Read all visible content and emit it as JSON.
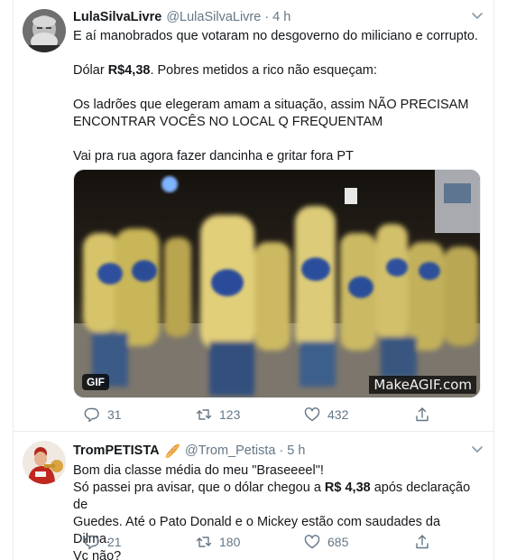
{
  "tweets": [
    {
      "display_name": "LulaSilvaLivre",
      "handle": "@LulaSilvaLivre",
      "dot": "·",
      "time": "4 h",
      "lines": [
        "E aí manobrados que votaram no desgoverno do miliciano e corrupto.",
        "",
        "Dólar R$4,38. Pobres metidos a rico não  esqueçam:",
        "",
        "Os ladrões que elegeram amam a situação, assim NÃO PRECISAM",
        "ENCONTRAR VOCÊS NO LOCAL Q FREQUENTAM",
        "",
        "Vai pra rua agora fazer dancinha e gritar fora PT"
      ],
      "dollar_prefix": "Dólar ",
      "dollar_value": "R$4,38",
      "dollar_suffix": ". Pobres metidos a rico não  esqueçam:",
      "media": {
        "gif_label": "GIF",
        "watermark": "MakeAGIF.com"
      },
      "replies": "31",
      "retweets": "123",
      "likes": "432"
    },
    {
      "display_name": "TromPETISTA",
      "emoji": "🥖",
      "handle": "@Trom_Petista",
      "dot": "·",
      "time": "5 h",
      "line1": "Bom dia classe média do meu \"Braseeeel\"!",
      "line2_prefix": "Só passei pra avisar, que o dólar chegou a ",
      "line2_value": "R$ 4,38",
      "line2_suffix": " após declaração de",
      "line3": "Guedes. Até o Pato Donald e o Mickey estão com saudades da Dilma.",
      "line4": "Vc não?",
      "replies": "21",
      "retweets": "180",
      "likes": "685"
    }
  ],
  "icons": {
    "reply": "reply-icon",
    "retweet": "retweet-icon",
    "like": "heart-icon",
    "share": "share-icon",
    "caret": "chevron-down-icon"
  },
  "colors": {
    "text": "#14171a",
    "muted": "#657786",
    "border": "#e6ecf0"
  }
}
